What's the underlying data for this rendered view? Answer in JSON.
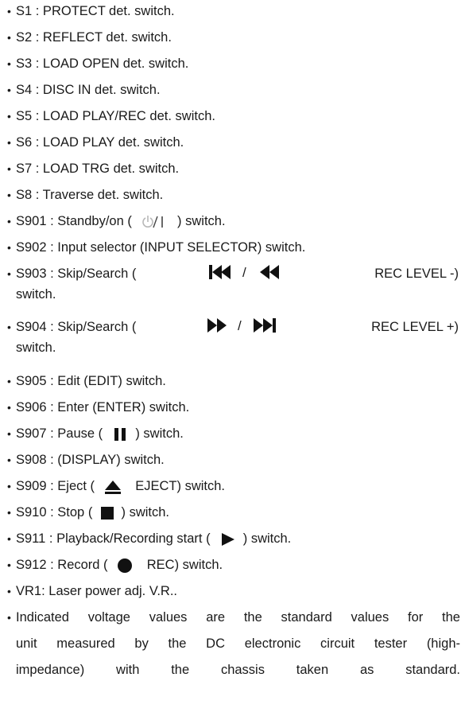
{
  "items": [
    {
      "text": "S1 : PROTECT det. switch."
    },
    {
      "text": "S2 : REFLECT det. switch."
    },
    {
      "text": "S3 : LOAD OPEN det. switch."
    },
    {
      "text": "S4 : DISC IN det. switch."
    },
    {
      "text": "S5 : LOAD PLAY/REC det. switch."
    },
    {
      "text": "S6 : LOAD PLAY det. switch."
    },
    {
      "text": "S7 : LOAD TRG det. switch."
    },
    {
      "text": "S8 : Traverse det. switch."
    },
    {
      "before": "S901 : Standby/on (",
      "after": ") switch.",
      "icon": "standby-on-icon"
    },
    {
      "text": "S902 : Input selector (INPUT SELECTOR) switch."
    },
    {
      "before": "S903 : Skip/Search (",
      "after": "REC LEVEL -)",
      "line2": "switch.",
      "icon": "skip-back-search-back-icon",
      "separator": "/"
    },
    {
      "before": "S904 : Skip/Search (",
      "after": "REC LEVEL +)",
      "line2": "switch.",
      "icon": "fast-forward-skip-forward-icon",
      "separator": "/"
    },
    {
      "text": "S905 : Edit (EDIT) switch."
    },
    {
      "text": "S906 : Enter (ENTER) switch."
    },
    {
      "before": "S907 : Pause (",
      "after": ") switch.",
      "icon": "pause-icon"
    },
    {
      "text": "S908 : (DISPLAY) switch."
    },
    {
      "before": "S909 : Eject (",
      "after": "EJECT) switch.",
      "icon": "eject-icon"
    },
    {
      "before": "S910 : Stop (",
      "after": ") switch.",
      "icon": "stop-icon"
    },
    {
      "before": "S911 : Playback/Recording start (",
      "after": ") switch.",
      "icon": "play-icon"
    },
    {
      "before": "S912 : Record (",
      "after": "REC) switch.",
      "icon": "record-icon"
    },
    {
      "text": "VR1: Laser power adj. V.R.."
    },
    {
      "lines": [
        "Indicated voltage values are the standard values for the",
        "unit measured by the DC electronic circuit tester (high-",
        "impedance) with the chassis taken as standard."
      ]
    }
  ]
}
